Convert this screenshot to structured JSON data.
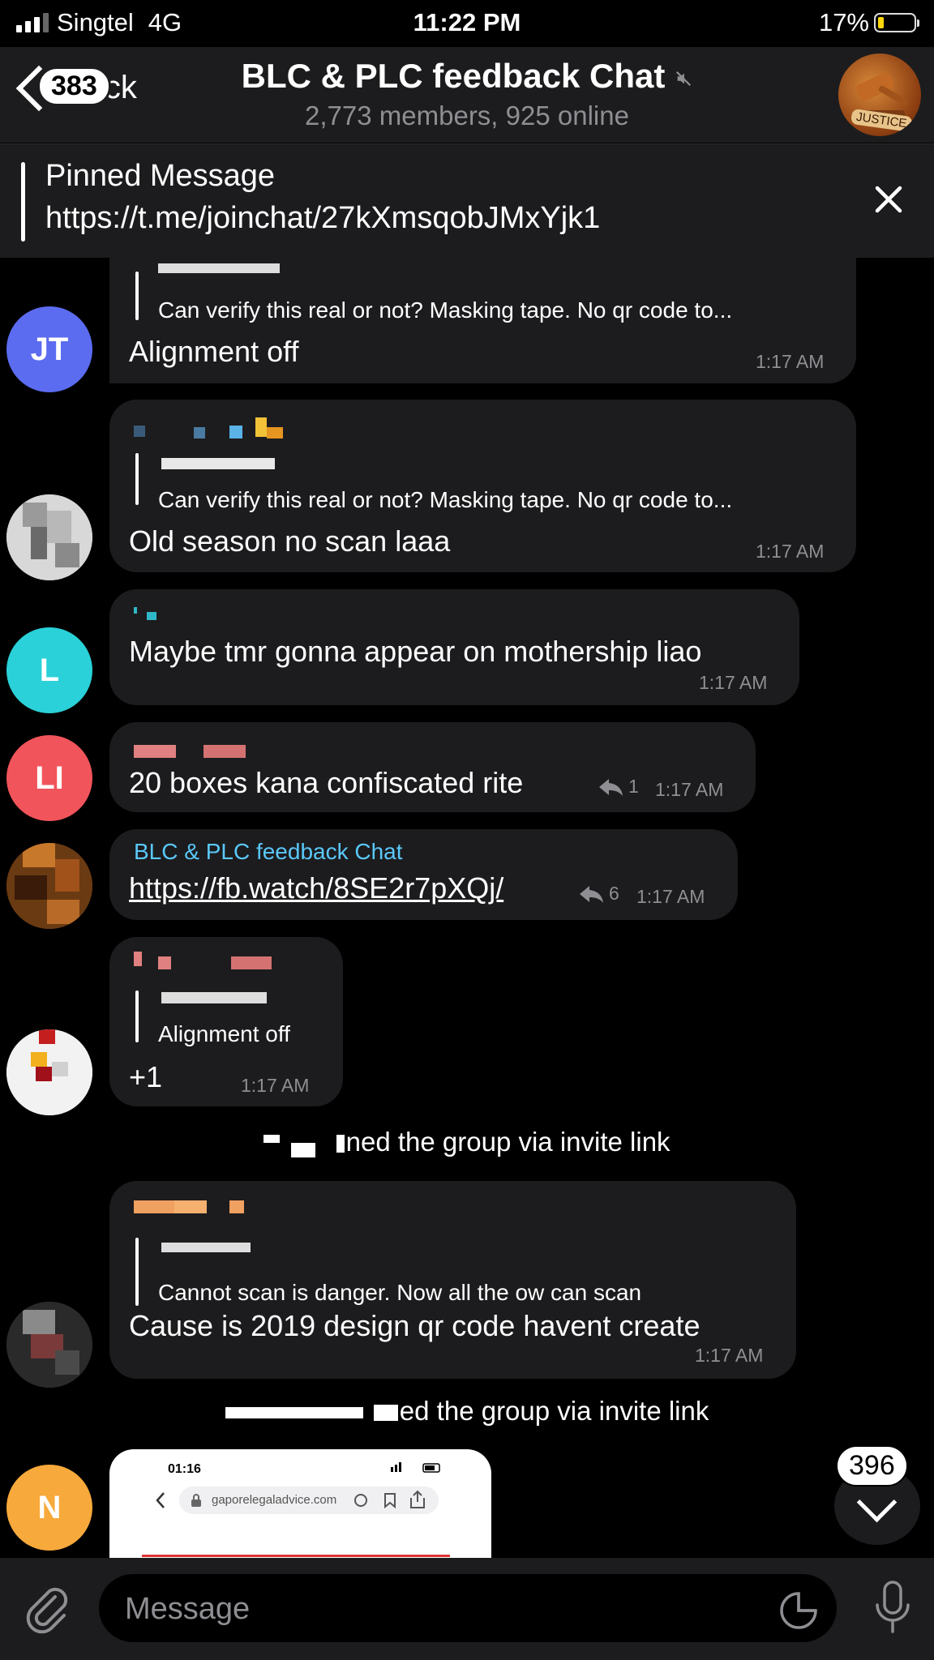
{
  "status_bar": {
    "carrier": "Singtel",
    "network": "4G",
    "time": "11:22 PM",
    "battery_percent": "17%",
    "battery_level": 0.17
  },
  "header": {
    "back_label": "Back",
    "back_badge": "383",
    "title": "BLC & PLC feedback Chat",
    "subtitle": "2,773 members, 925 online",
    "avatar_text": "JUSTICE"
  },
  "pinned": {
    "title": "Pinned Message",
    "link": "https://t.me/joinchat/27kXmsqobJMxYjk1"
  },
  "messages": [
    {
      "avatar": "JT",
      "reply_text": "Can verify this real or not? Masking tape. No qr code to...",
      "text": "Alignment off",
      "time": "1:17 AM"
    },
    {
      "reply_text": "Can verify this real or not? Masking tape. No qr code to...",
      "text": "Old season no scan laaa",
      "time": "1:17 AM"
    },
    {
      "avatar": "L",
      "text": "Maybe tmr gonna appear on mothership liao",
      "time": "1:17 AM"
    },
    {
      "avatar": "LI",
      "text": "20 boxes kana confiscated rite",
      "shares": "1",
      "time": "1:17 AM"
    },
    {
      "sender": "BLC & PLC feedback Chat",
      "text": "https://fb.watch/8SE2r7pXQj/",
      "shares": "6",
      "time": "1:17 AM"
    },
    {
      "reply_text": "Alignment off",
      "text": "+1",
      "time": "1:17 AM"
    },
    {
      "reply_text": "Cannot scan is danger. Now all the ow can scan",
      "text": "Cause is 2019 design qr code havent create",
      "time": "1:17 AM"
    },
    {
      "avatar": "N",
      "thumb_time": "01:16",
      "thumb_url": "gaporelegaladvice.com"
    }
  ],
  "service": [
    "ned the group via invite link",
    "ed the group via invite link"
  ],
  "scroll": {
    "badge": "396"
  },
  "input": {
    "placeholder": "Message"
  },
  "colors": {
    "bubble": "#1c1c1e",
    "accent_link": "#5ac8fa",
    "avatar_jt": "#5b6cf0",
    "avatar_l": "#2ad1d8",
    "avatar_li": "#f2545b",
    "avatar_n": "#f7a93b"
  }
}
